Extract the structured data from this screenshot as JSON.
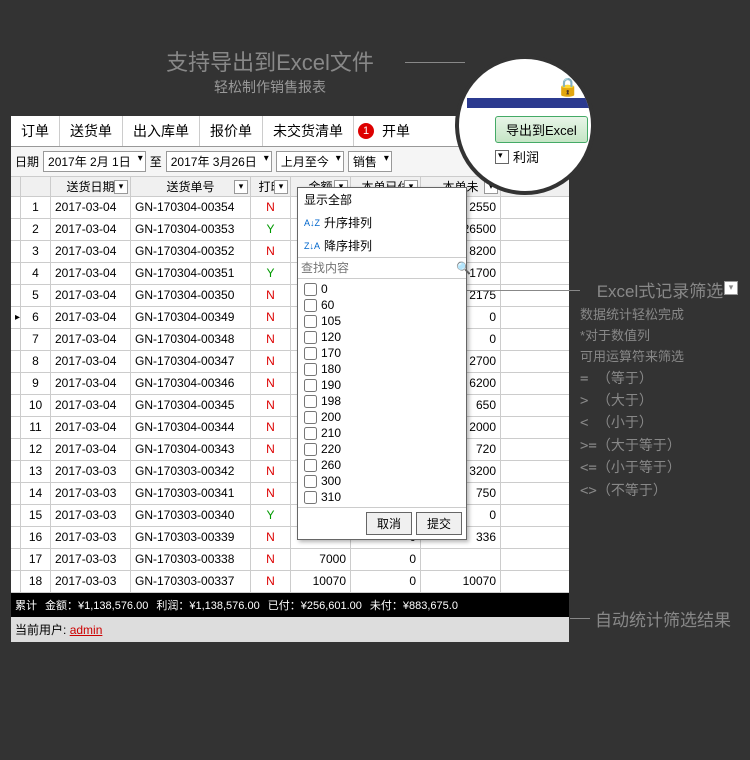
{
  "annotations": {
    "top_title": "支持导出到Excel文件",
    "top_sub": "轻松制作销售报表",
    "right_title": "Excel式记录筛选",
    "right_sub": "数据统计轻松完成",
    "right_note1": "*对于数值列",
    "right_note2": "可用运算符来筛选",
    "ops": [
      "=  （等于）",
      ">  （大于）",
      "<  （小于）",
      ">=（大于等于）",
      "<=（小于等于）",
      "<>（不等于）"
    ],
    "bottom_label": "自动统计筛选结果"
  },
  "tabs": [
    "订单",
    "送货单",
    "出入库单",
    "报价单",
    "未交货清单"
  ],
  "tab_active": "开单",
  "tab_badge": "1",
  "filter": {
    "date_label": "日期",
    "from": "2017年 2月 1日",
    "to_label": "至",
    "to": "2017年 3月26日",
    "range": "上月至今",
    "type": "销售"
  },
  "columns": [
    "送货日期",
    "送货单号",
    "打印",
    "金额",
    "本单已付",
    "本单未"
  ],
  "rows": [
    {
      "n": 1,
      "date": "2017-03-04",
      "order": "GN-170304-00354",
      "print": "N",
      "amt": "",
      "paid": "",
      "unpaid": "2550"
    },
    {
      "n": 2,
      "date": "2017-03-04",
      "order": "GN-170304-00353",
      "print": "Y",
      "amt": "",
      "paid": "",
      "unpaid": "26500"
    },
    {
      "n": 3,
      "date": "2017-03-04",
      "order": "GN-170304-00352",
      "print": "N",
      "amt": "",
      "paid": "",
      "unpaid": "8200"
    },
    {
      "n": 4,
      "date": "2017-03-04",
      "order": "GN-170304-00351",
      "print": "Y",
      "amt": "",
      "paid": "",
      "unpaid": "1700"
    },
    {
      "n": 5,
      "date": "2017-03-04",
      "order": "GN-170304-00350",
      "print": "N",
      "amt": "",
      "paid": "",
      "unpaid": "2175"
    },
    {
      "n": 6,
      "date": "2017-03-04",
      "order": "GN-170304-00349",
      "print": "N",
      "amt": "",
      "paid": "",
      "unpaid": "0",
      "marker": "▸"
    },
    {
      "n": 7,
      "date": "2017-03-04",
      "order": "GN-170304-00348",
      "print": "N",
      "amt": "",
      "paid": "",
      "unpaid": "0"
    },
    {
      "n": 8,
      "date": "2017-03-04",
      "order": "GN-170304-00347",
      "print": "N",
      "amt": "",
      "paid": "",
      "unpaid": "2700"
    },
    {
      "n": 9,
      "date": "2017-03-04",
      "order": "GN-170304-00346",
      "print": "N",
      "amt": "",
      "paid": "",
      "unpaid": "6200"
    },
    {
      "n": 10,
      "date": "2017-03-04",
      "order": "GN-170304-00345",
      "print": "N",
      "amt": "",
      "paid": "",
      "unpaid": "650"
    },
    {
      "n": 11,
      "date": "2017-03-04",
      "order": "GN-170304-00344",
      "print": "N",
      "amt": "",
      "paid": "",
      "unpaid": "2000"
    },
    {
      "n": 12,
      "date": "2017-03-04",
      "order": "GN-170304-00343",
      "print": "N",
      "amt": "",
      "paid": "",
      "unpaid": "720"
    },
    {
      "n": 13,
      "date": "2017-03-03",
      "order": "GN-170303-00342",
      "print": "N",
      "amt": "",
      "paid": "",
      "unpaid": "3200"
    },
    {
      "n": 14,
      "date": "2017-03-03",
      "order": "GN-170303-00341",
      "print": "N",
      "amt": "",
      "paid": "",
      "unpaid": "750"
    },
    {
      "n": 15,
      "date": "2017-03-03",
      "order": "GN-170303-00340",
      "print": "Y",
      "amt": "",
      "paid": "",
      "unpaid": "0"
    },
    {
      "n": 16,
      "date": "2017-03-03",
      "order": "GN-170303-00339",
      "print": "N",
      "amt": "",
      "paid": "0",
      "unpaid": "336"
    },
    {
      "n": 17,
      "date": "2017-03-03",
      "order": "GN-170303-00338",
      "print": "N",
      "amt": "7000",
      "paid": "0",
      "unpaid": ""
    },
    {
      "n": 18,
      "date": "2017-03-03",
      "order": "GN-170303-00337",
      "print": "N",
      "amt": "10070",
      "paid": "0",
      "unpaid": "10070"
    }
  ],
  "summary": {
    "label": "累计",
    "amount": "金额：¥1,138,576.00",
    "profit": "利润：¥1,138,576.00",
    "paid": "已付：¥256,601.00",
    "unpaid": "未付：¥883,675.0"
  },
  "userbar": {
    "label": "当前用户:",
    "user": "admin"
  },
  "popup": {
    "show_all": "显示全部",
    "sort_asc": "升序排列",
    "sort_desc": "降序排列",
    "search_ph": "查找内容",
    "options": [
      "0",
      "60",
      "105",
      "120",
      "170",
      "180",
      "190",
      "198",
      "200",
      "210",
      "220",
      "260",
      "300",
      "310"
    ],
    "cancel": "取消",
    "submit": "提交"
  },
  "zoom": {
    "export_btn": "导出到Excel",
    "profit": "利润"
  }
}
